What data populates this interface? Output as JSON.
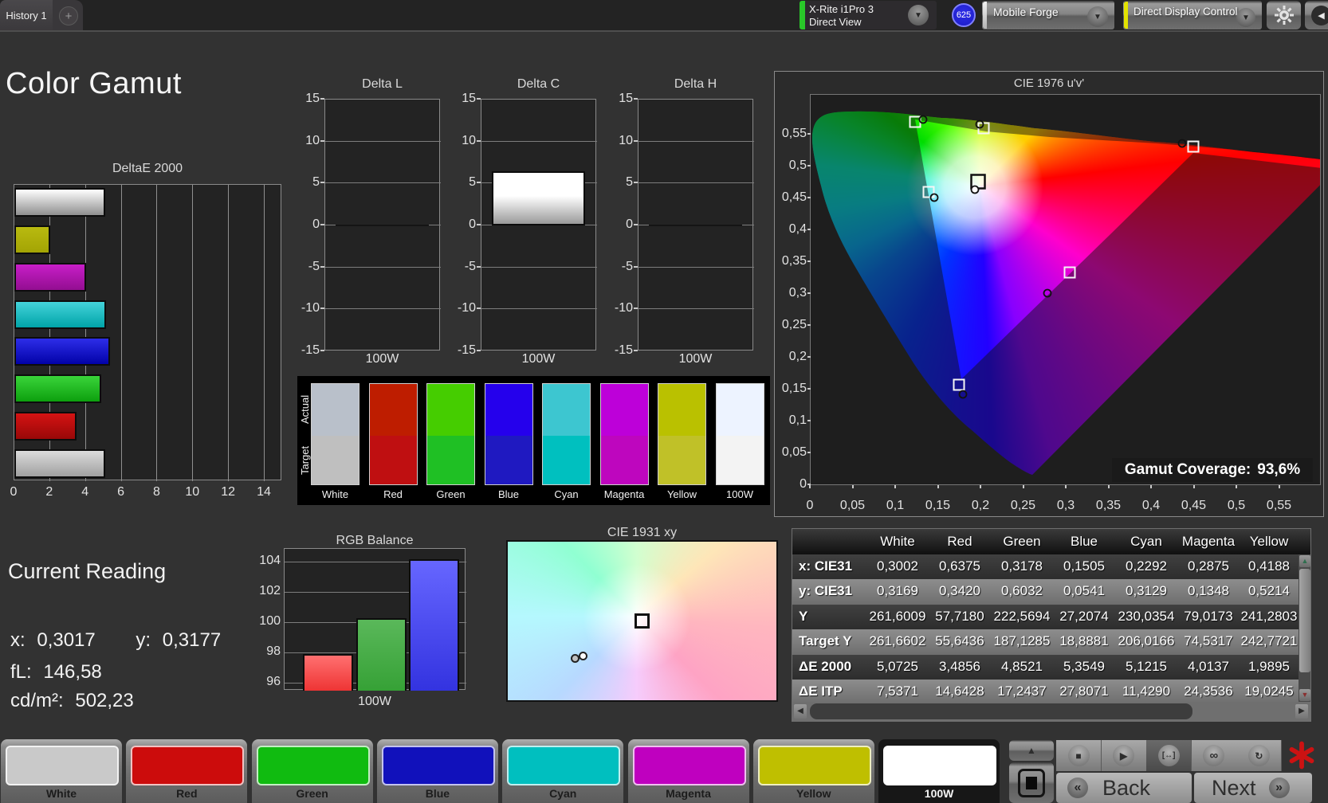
{
  "top_bar": {
    "tab": "History 1",
    "add_tab": "+",
    "meter": {
      "line1": "X-Rite i1Pro 3",
      "line2": "Direct View",
      "badge": "625"
    },
    "source": "Mobile Forge",
    "control": "Direct Display Control"
  },
  "page_title": "Color Gamut",
  "delta_charts": {
    "y_ticks": [
      "15",
      "10",
      "5",
      "0",
      "-5",
      "-10",
      "-15"
    ],
    "x_label": "100W",
    "charts": [
      {
        "title": "Delta L",
        "value": 0
      },
      {
        "title": "Delta C",
        "value": 6.5
      },
      {
        "title": "Delta H",
        "value": 0
      }
    ]
  },
  "deltae_chart": {
    "title": "DeltaE 2000",
    "x_ticks": [
      "0",
      "2",
      "4",
      "6",
      "8",
      "10",
      "12",
      "14"
    ],
    "bars": [
      {
        "name": "White",
        "value": 5.07,
        "c1": "#ffffff",
        "c2": "#8f8f8f"
      },
      {
        "name": "Yellow",
        "value": 1.99,
        "c1": "#b9ba10",
        "c2": "#a3a404"
      },
      {
        "name": "Magenta",
        "value": 4.01,
        "c1": "#c81ec8",
        "c2": "#930e91"
      },
      {
        "name": "Cyan",
        "value": 5.12,
        "c1": "#44d3da",
        "c2": "#00a4a8"
      },
      {
        "name": "Blue",
        "value": 5.35,
        "c1": "#2d2de8",
        "c2": "#0202a8"
      },
      {
        "name": "Green",
        "value": 4.85,
        "c1": "#3ad43a",
        "c2": "#0da00e"
      },
      {
        "name": "Red",
        "value": 3.49,
        "c1": "#d51313",
        "c2": "#990808"
      },
      {
        "name": "100W",
        "value": 5.07,
        "c1": "#dcdcdc",
        "c2": "#a0a0a0"
      }
    ]
  },
  "swatch_strip": {
    "row_labels": [
      "Actual",
      "Target"
    ],
    "columns": [
      {
        "label": "White",
        "actual": "#b9c0ca",
        "target": "#bfbfbf"
      },
      {
        "label": "Red",
        "actual": "#be1d00",
        "target": "#bf0f11"
      },
      {
        "label": "Green",
        "actual": "#45cd00",
        "target": "#1fc024"
      },
      {
        "label": "Blue",
        "actual": "#2500ec",
        "target": "#1f19c1"
      },
      {
        "label": "Cyan",
        "actual": "#3dc6d0",
        "target": "#00c0bf"
      },
      {
        "label": "Magenta",
        "actual": "#bd00d9",
        "target": "#be06be"
      },
      {
        "label": "Yellow",
        "actual": "#bac100",
        "target": "#c0c128"
      },
      {
        "label": "100W",
        "actual": "#edf3ff",
        "target": "#f3f3f3"
      }
    ]
  },
  "cie1976": {
    "title": "CIE 1976 u'v'",
    "coverage_label": "Gamut Coverage:",
    "coverage_value": "93,6%",
    "y_ticks": [
      "0,55",
      "0,5",
      "0,45",
      "0,4",
      "0,35",
      "0,3",
      "0,25",
      "0,2",
      "0,15",
      "0,1",
      "0,05",
      "0"
    ],
    "x_ticks": [
      "0",
      "0,05",
      "0,1",
      "0,15",
      "0,2",
      "0,25",
      "0,3",
      "0,35",
      "0,4",
      "0,45",
      "0,5",
      "0,55"
    ],
    "markers": [
      {
        "name": "green",
        "sq": [
          131,
          34
        ],
        "pt": [
          141,
          31
        ]
      },
      {
        "name": "yellow",
        "sq": [
          217,
          42
        ],
        "pt": [
          212,
          37
        ]
      },
      {
        "name": "red",
        "sq": [
          480,
          65
        ],
        "pt": [
          466,
          61
        ]
      },
      {
        "name": "white",
        "sq": [
          210,
          109
        ],
        "pt": [
          206,
          119
        ]
      },
      {
        "name": "cyan",
        "sq": [
          148,
          122
        ],
        "pt": [
          155,
          129
        ]
      },
      {
        "name": "magenta",
        "sq": [
          325,
          223
        ],
        "pt": [
          297,
          249
        ]
      },
      {
        "name": "blue",
        "sq": [
          186,
          364
        ],
        "pt": [
          191,
          376
        ]
      }
    ]
  },
  "current_reading": {
    "heading": "Current Reading",
    "x_label": "x:",
    "x_value": "0,3017",
    "y_label": "y:",
    "y_value": "0,3177",
    "fl_label": "fL:",
    "fl_value": "146,58",
    "cd_label": "cd/m²:",
    "cd_value": "502,23"
  },
  "rgb_balance": {
    "title": "RGB Balance",
    "x_label": "100W",
    "y_ticks": [
      "104",
      "102",
      "100",
      "98",
      "96"
    ],
    "bars": [
      {
        "name": "red",
        "value": 97.9,
        "c1": "#ff7070",
        "c2": "#ee3434"
      },
      {
        "name": "green",
        "value": 100.25,
        "c1": "#5ab85a",
        "c2": "#36a136"
      },
      {
        "name": "blue",
        "value": 104.15,
        "c1": "#6666ff",
        "c2": "#3333e0"
      }
    ]
  },
  "cie1931": {
    "title": "CIE 1931 xy"
  },
  "table": {
    "headers": [
      "",
      "White",
      "Red",
      "Green",
      "Blue",
      "Cyan",
      "Magenta",
      "Yellow"
    ],
    "rows": [
      {
        "label": "x: CIE31",
        "values": [
          "0,3002",
          "0,6375",
          "0,3178",
          "0,1505",
          "0,2292",
          "0,2875",
          "0,4188"
        ]
      },
      {
        "label": "y: CIE31",
        "values": [
          "0,3169",
          "0,3420",
          "0,6032",
          "0,0541",
          "0,3129",
          "0,1348",
          "0,5214"
        ]
      },
      {
        "label": "Y",
        "values": [
          "261,6009",
          "57,7180",
          "222,5694",
          "27,2074",
          "230,0354",
          "79,0173",
          "241,2803"
        ]
      },
      {
        "label": "Target Y",
        "values": [
          "261,6602",
          "55,6436",
          "187,1285",
          "18,8881",
          "206,0166",
          "74,5317",
          "242,7721"
        ]
      },
      {
        "label": "ΔE 2000",
        "values": [
          "5,0725",
          "3,4856",
          "4,8521",
          "5,3549",
          "5,1215",
          "4,0137",
          "1,9895"
        ]
      },
      {
        "label": "ΔE ITP",
        "values": [
          "7,5371",
          "14,6428",
          "17,2437",
          "27,8071",
          "11,4290",
          "24,3536",
          "19,0245"
        ]
      }
    ]
  },
  "bottom": {
    "patterns": [
      {
        "label": "White",
        "color": "#c9c9c9",
        "selected": false
      },
      {
        "label": "Red",
        "color": "#cc0c0c",
        "selected": false
      },
      {
        "label": "Green",
        "color": "#10bb10",
        "selected": false
      },
      {
        "label": "Blue",
        "color": "#1111bb",
        "selected": false
      },
      {
        "label": "Cyan",
        "color": "#00bfbf",
        "selected": false
      },
      {
        "label": "Magenta",
        "color": "#bf00bf",
        "selected": false
      },
      {
        "label": "Yellow",
        "color": "#bfbf00",
        "selected": false
      },
      {
        "label": "100W",
        "color": "#ffffff",
        "selected": true
      }
    ],
    "back": "Back",
    "next": "Next",
    "back_glyph": "«",
    "next_glyph": "»"
  }
}
